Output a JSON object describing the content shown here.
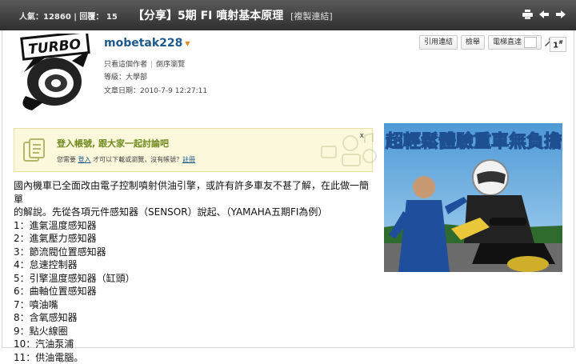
{
  "topbar": {
    "stats": "人氣：12860 | 回覆： 15",
    "title": "【分享】5期 FI 噴射基本原理",
    "copy_link": "[複製連結]",
    "icons": [
      "print-icon",
      "arrow-left-icon",
      "arrow-right-icon"
    ]
  },
  "post": {
    "avatar_text": "TURBO",
    "username": "mobetak228",
    "links": {
      "only_author": "只看這個作者",
      "reverse": "倒序瀏覽"
    },
    "level": "等級：大學部",
    "date": "文章日期：2010-7-9 12:27:11",
    "actions": {
      "quote": "引用連結",
      "report": "檢舉",
      "elevator": "電梯直達"
    },
    "floor": "1",
    "floor_suffix": "#"
  },
  "login_prompt": {
    "title": "登入帳號, 跟大家一起討論吧",
    "prefix": "您需要 ",
    "login_link": "登入",
    "middle": " 才可以下載或瀏覽，沒有帳號？",
    "register_link": "註冊",
    "close": "x"
  },
  "ad": {
    "headline": "超輕鬆體驗重車無負擔",
    "colors": {
      "sky": "#5ea7dc",
      "headline": "#ffffff",
      "outline": "#1d4f91"
    }
  },
  "content": {
    "intro_1": "國內機車已全面改由電子控制噴射供油引擎，或許有許多車友不甚了解，在此做一簡單",
    "intro_2": "的解說。先從各項元件感知器（SENSOR）說起、（YAMAHA五期FI為例）",
    "items": [
      "1：進氣溫度感知器",
      "2：進氣壓力感知器",
      "3：節流閥位置感知器",
      "4：怠速控制器",
      "5：引擎溫度感知器（缸頭）",
      "6：曲軸位置感知器",
      "7：噴油嘴",
      "8：含氧感知器",
      "9：點火線圈",
      "10：汽油泵浦",
      "11：供油電腦。"
    ]
  }
}
